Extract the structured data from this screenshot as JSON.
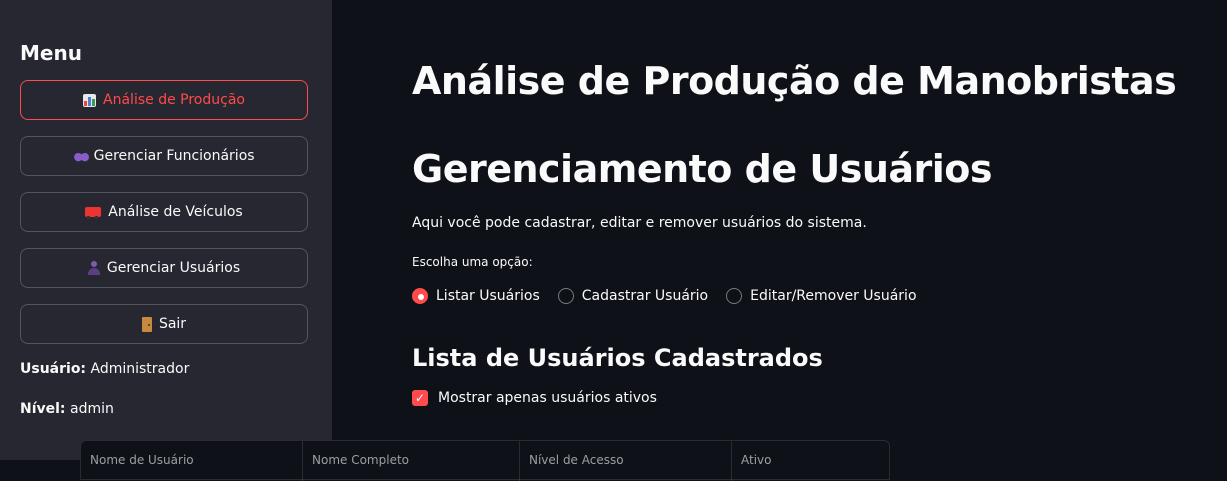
{
  "sidebar": {
    "title": "Menu",
    "buttons": [
      {
        "label": "Análise de Produção",
        "icon": "bar-chart-icon",
        "active": true
      },
      {
        "label": "Gerenciar Funcionários",
        "icon": "users-icon"
      },
      {
        "label": "Análise de Veículos",
        "icon": "truck-icon"
      },
      {
        "label": "Gerenciar Usuários",
        "icon": "person-icon"
      },
      {
        "label": "Sair",
        "icon": "door-icon"
      }
    ],
    "user_label": "Usuário:",
    "user_value": "Administrador",
    "level_label": "Nível:",
    "level_value": "admin"
  },
  "main": {
    "title": "Análise de Produção de Manobristas",
    "subtitle": "Gerenciamento de Usuários",
    "description": "Aqui você pode cadastrar, editar e remover usuários do sistema.",
    "radio_label": "Escolha uma opção:",
    "radio_options": [
      "Listar Usuários",
      "Cadastrar Usuário",
      "Editar/Remover Usuário"
    ],
    "radio_selected": "Listar Usuários",
    "section_title": "Lista de Usuários Cadastrados",
    "checkbox_label": "Mostrar apenas usuários ativos",
    "checkbox_checked": true,
    "table_headers": [
      "Nome de Usuário",
      "Nome Completo",
      "Nível de Acesso",
      "Ativo"
    ]
  },
  "colors": {
    "accent": "#ff4b4b",
    "sidebar_bg": "#262730",
    "main_bg": "#0e1117"
  }
}
